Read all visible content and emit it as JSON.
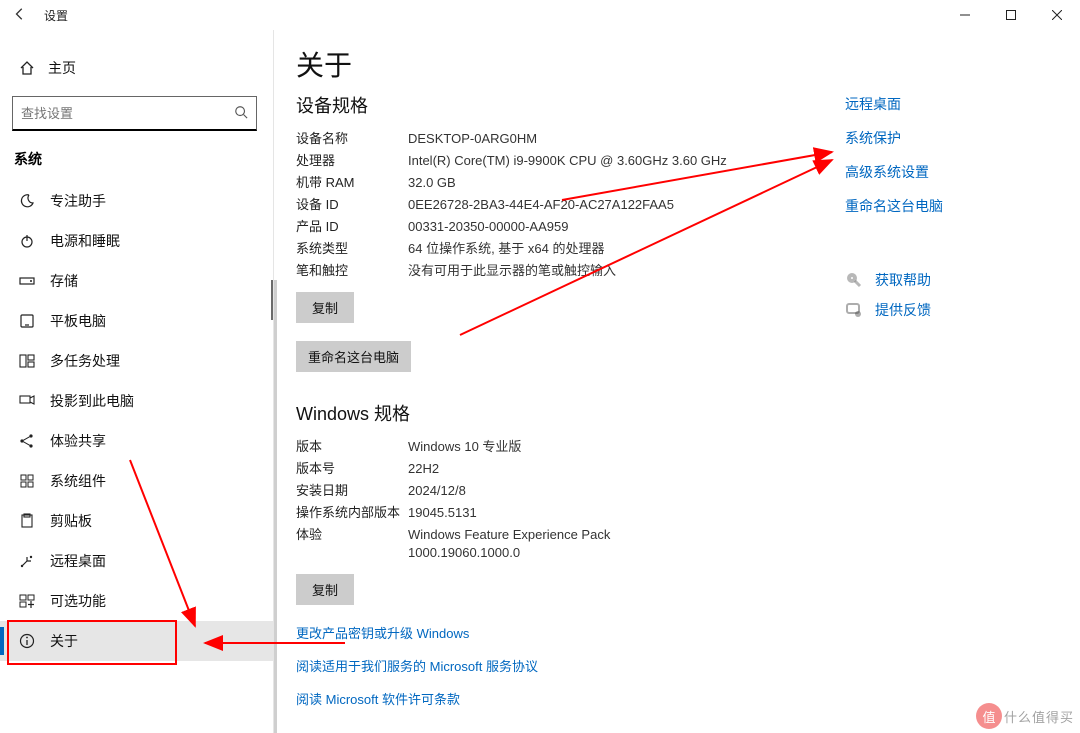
{
  "window": {
    "title": "设置",
    "min": "—",
    "max": "☐",
    "close": "✕"
  },
  "sidebar": {
    "home": "主页",
    "search_placeholder": "查找设置",
    "group": "系统",
    "items": [
      {
        "label": "专注助手"
      },
      {
        "label": "电源和睡眠"
      },
      {
        "label": "存储"
      },
      {
        "label": "平板电脑"
      },
      {
        "label": "多任务处理"
      },
      {
        "label": "投影到此电脑"
      },
      {
        "label": "体验共享"
      },
      {
        "label": "系统组件"
      },
      {
        "label": "剪贴板"
      },
      {
        "label": "远程桌面"
      },
      {
        "label": "可选功能"
      },
      {
        "label": "关于"
      }
    ]
  },
  "about": {
    "title": "关于",
    "device_specs_head": "设备规格",
    "rows": {
      "device_name_l": "设备名称",
      "device_name_v": "DESKTOP-0ARG0HM",
      "cpu_l": "处理器",
      "cpu_v": "Intel(R) Core(TM) i9-9900K CPU @ 3.60GHz   3.60 GHz",
      "ram_l": "机带 RAM",
      "ram_v": "32.0 GB",
      "devid_l": "设备 ID",
      "devid_v": "0EE26728-2BA3-44E4-AF20-AC27A122FAA5",
      "prodid_l": "产品 ID",
      "prodid_v": "00331-20350-00000-AA959",
      "systype_l": "系统类型",
      "systype_v": "64 位操作系统, 基于 x64 的处理器",
      "pen_l": "笔和触控",
      "pen_v": "没有可用于此显示器的笔或触控输入"
    },
    "copy1": "复制",
    "rename_btn": "重命名这台电脑",
    "win_specs_head": "Windows 规格",
    "win": {
      "edition_l": "版本",
      "edition_v": "Windows 10 专业版",
      "ver_l": "版本号",
      "ver_v": "22H2",
      "install_l": "安装日期",
      "install_v": "2024/12/8",
      "build_l": "操作系统内部版本",
      "build_v": "19045.5131",
      "exp_l": "体验",
      "exp_v": "Windows Feature Experience Pack 1000.19060.1000.0"
    },
    "copy2": "复制",
    "links": {
      "upgrade": "更改产品密钥或升级 Windows",
      "msa": "阅读适用于我们服务的 Microsoft 服务协议",
      "license": "阅读 Microsoft 软件许可条款"
    }
  },
  "right": {
    "remote": "远程桌面",
    "protection": "系统保护",
    "advanced": "高级系统设置",
    "rename": "重命名这台电脑",
    "help": "获取帮助",
    "feedback": "提供反馈"
  },
  "watermark": {
    "badge": "值",
    "text": "什么值得买"
  }
}
